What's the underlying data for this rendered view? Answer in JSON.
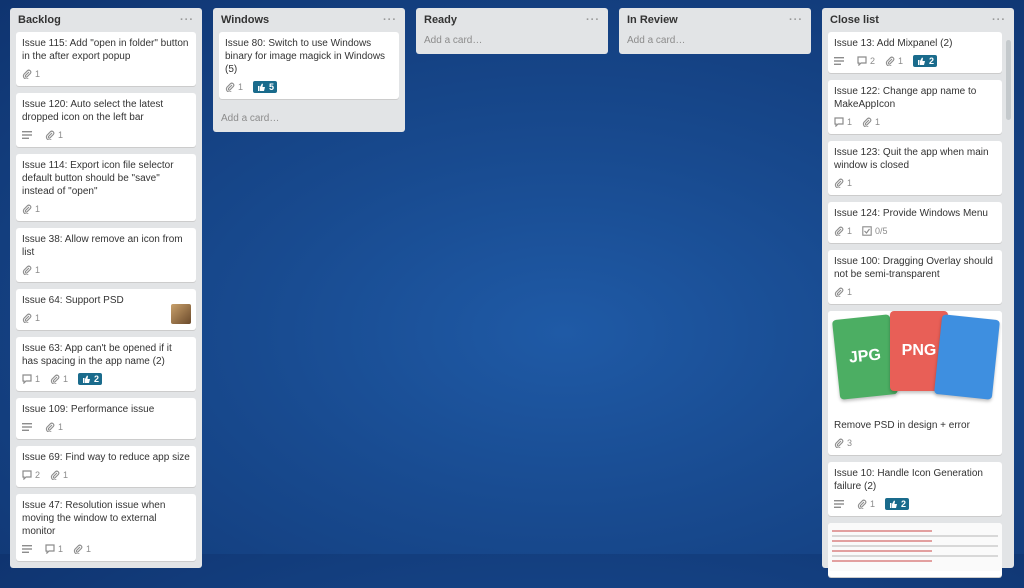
{
  "lists": [
    {
      "title": "Backlog",
      "cards": [
        {
          "title": "Issue 115: Add \"open in folder\" button in the after export popup",
          "attachments": "1"
        },
        {
          "title": "Issue 120: Auto select the latest dropped icon on the left bar",
          "description": true,
          "attachments": "1"
        },
        {
          "title": "Issue 114: Export icon file selector default button should be \"save\" instead of \"open\"",
          "attachments": "1"
        },
        {
          "title": "Issue 38: Allow remove an icon from list",
          "attachments": "1"
        },
        {
          "title": "Issue 64: Support PSD",
          "attachments": "1",
          "avatar": true
        },
        {
          "title": "Issue 63: App can't be opened if it has spacing in the app name (2)",
          "comments": "1",
          "attachments": "1",
          "votes": "2"
        },
        {
          "title": "Issue 109: Performance issue",
          "description": true,
          "attachments": "1"
        },
        {
          "title": "Issue 69: Find way to reduce app size",
          "comments": "2",
          "attachments": "1"
        },
        {
          "title": "Issue 47: Resolution issue when moving the window to external monitor",
          "description": true,
          "comments": "1",
          "attachments": "1"
        }
      ]
    },
    {
      "title": "Windows",
      "cards": [
        {
          "title": "Issue 80: Switch to use Windows binary for image magick in Windows (5)",
          "attachments": "1",
          "votes": "5"
        }
      ],
      "add_card": "Add a card…"
    },
    {
      "title": "Ready",
      "cards": [],
      "add_card": "Add a card…"
    },
    {
      "title": "In Review",
      "cards": [],
      "add_card": "Add a card…"
    },
    {
      "title": "Close list",
      "cards": [
        {
          "title": "Issue 13: Add Mixpanel (2)",
          "description": true,
          "comments": "2",
          "attachments": "1",
          "votes": "2"
        },
        {
          "title": "Issue 122: Change app name to MakeAppIcon",
          "comments": "1",
          "attachments": "1"
        },
        {
          "title": "Issue 123: Quit the app when main window is closed",
          "attachments": "1"
        },
        {
          "title": "Issue 124: Provide Windows Menu",
          "attachments": "1",
          "checklist": "0/5"
        },
        {
          "title": "Issue 100: Dragging Overlay should not be semi-transparent",
          "attachments": "1"
        },
        {
          "title": "Remove PSD in design + error",
          "attachments": "3",
          "cover": [
            "JPG",
            "PNG"
          ]
        },
        {
          "title": "Issue 10: Handle Icon Generation failure (2)",
          "description": true,
          "attachments": "1",
          "votes": "2"
        }
      ]
    }
  ],
  "menu_glyph": "···",
  "colors": {
    "board": "#184a8f",
    "list": "#e2e4e6",
    "vote_badge": "#1a6b8c"
  },
  "icons": {
    "description": "lines-icon",
    "comments": "speech-bubble-icon",
    "attachments": "paperclip-icon",
    "votes": "thumbs-up-icon",
    "checklist": "checkbox-icon"
  }
}
